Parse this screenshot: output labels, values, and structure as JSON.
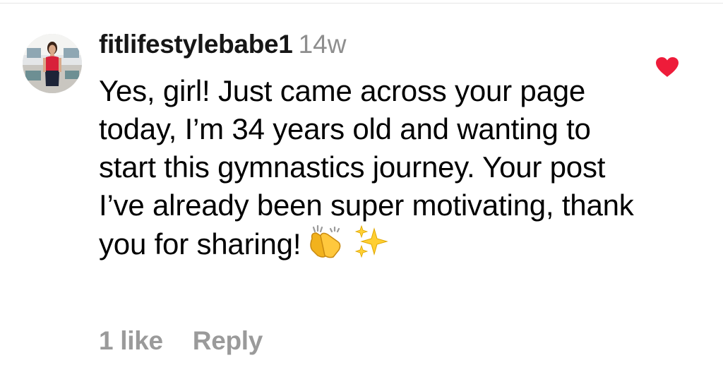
{
  "comment": {
    "username": "fitlifestylebabe1",
    "timestamp": "14w",
    "text": "Yes, girl! Just came across your page today, I’m 34 years old and wanting to start this gymnastics journey. Your post I’ve already been super motivating, thank you for sharing!",
    "emojis": [
      "👏",
      "✨"
    ],
    "likes_label": "1 like",
    "reply_label": "Reply",
    "liked": true
  },
  "colors": {
    "username": "#161616",
    "timestamp": "#8e8e8e",
    "action_text": "#9a9a9a",
    "heart": "#ee1c3a"
  },
  "icons": {
    "like": "heart-icon",
    "clap": "clapping-hands-emoji",
    "sparkles": "sparkles-emoji"
  }
}
